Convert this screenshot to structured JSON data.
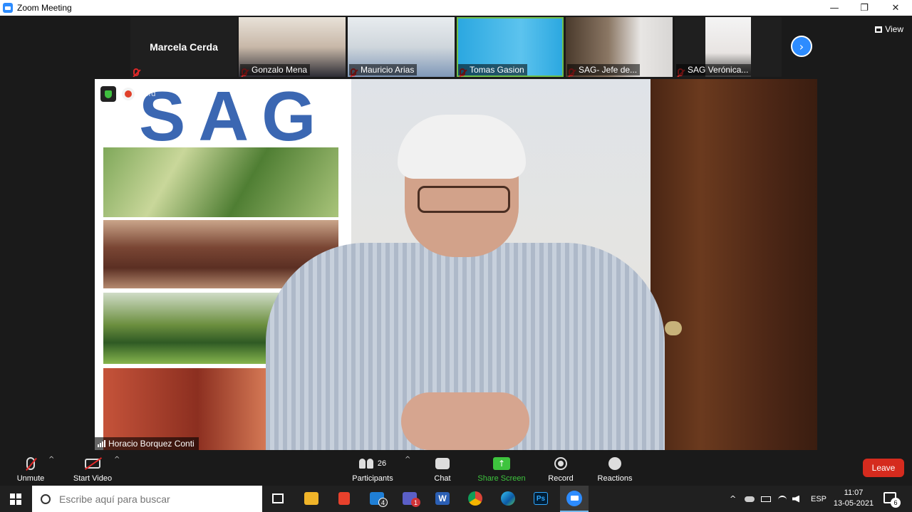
{
  "window": {
    "title": "Zoom Meeting",
    "controls": {
      "minimize": "—",
      "restore": "❐",
      "close": "✕"
    }
  },
  "top_strip": {
    "dark_tile_name": "Marcela Cerda",
    "tiles": [
      {
        "name": "Gonzalo Mena"
      },
      {
        "name": "Mauricio Arias"
      },
      {
        "name": "Tomas Gasion"
      },
      {
        "name": "SAG- Jefe de..."
      },
      {
        "name": "SAG Verónica..."
      }
    ],
    "view_label": "View",
    "next_icon": "›"
  },
  "main_video": {
    "speaker_name": "Horacio Borquez Conti",
    "poster_text": "SAG",
    "recording_text": "cord"
  },
  "toolbar": {
    "unmute": "Unmute",
    "start_video": "Start Video",
    "participants": "Participants",
    "participants_count": "26",
    "chat": "Chat",
    "share_screen": "Share Screen",
    "record": "Record",
    "reactions": "Reactions",
    "leave": "Leave",
    "caret": "^",
    "share_arrow": "↑"
  },
  "taskbar": {
    "search_placeholder": "Escribe aquí para buscar",
    "mail_badge": "4",
    "teams_badge": "1",
    "word_letter": "W",
    "ps_label": "Ps",
    "language": "ESP",
    "time": "11:07",
    "date": "13-05-2021",
    "notifications": "6",
    "tray_up_arrow": "^"
  }
}
